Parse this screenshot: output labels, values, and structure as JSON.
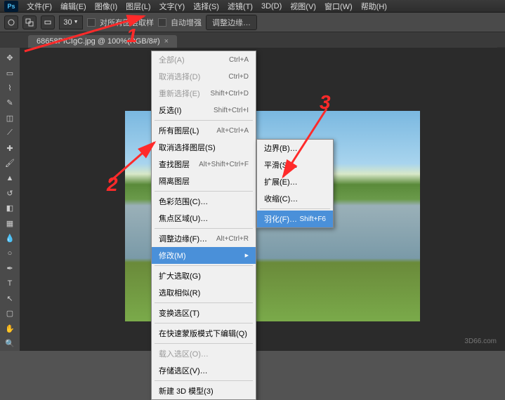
{
  "app": {
    "logo": "Ps"
  },
  "menubar": [
    "文件(F)",
    "编辑(E)",
    "图像(I)",
    "图层(L)",
    "文字(Y)",
    "选择(S)",
    "滤镜(T)",
    "3D(D)",
    "视图(V)",
    "窗口(W)",
    "帮助(H)"
  ],
  "options": {
    "size_value": "30",
    "chk1_label": "对所有图层取样",
    "chk2_label": "自动增强",
    "refine_btn": "调整边缘…"
  },
  "document": {
    "tab_title": "68658PICIgC.jpg @ 100%(RGB/8#)",
    "close": "×"
  },
  "select_menu": [
    {
      "label": "全部(A)",
      "shortcut": "Ctrl+A",
      "disabled": true
    },
    {
      "label": "取消选择(D)",
      "shortcut": "Ctrl+D",
      "disabled": true
    },
    {
      "label": "重新选择(E)",
      "shortcut": "Shift+Ctrl+D",
      "disabled": true
    },
    {
      "label": "反选(I)",
      "shortcut": "Shift+Ctrl+I"
    },
    {
      "sep": true
    },
    {
      "label": "所有图层(L)",
      "shortcut": "Alt+Ctrl+A"
    },
    {
      "label": "取消选择图层(S)"
    },
    {
      "label": "查找图层",
      "shortcut": "Alt+Shift+Ctrl+F"
    },
    {
      "label": "隔离图层"
    },
    {
      "sep": true
    },
    {
      "label": "色彩范围(C)…"
    },
    {
      "label": "焦点区域(U)…"
    },
    {
      "sep": true
    },
    {
      "label": "调整边缘(F)…",
      "shortcut": "Alt+Ctrl+R"
    },
    {
      "label": "修改(M)",
      "sub": true,
      "sel": true
    },
    {
      "sep": true
    },
    {
      "label": "扩大选取(G)"
    },
    {
      "label": "选取相似(R)"
    },
    {
      "sep": true
    },
    {
      "label": "变换选区(T)"
    },
    {
      "sep": true
    },
    {
      "label": "在快速蒙版模式下编辑(Q)"
    },
    {
      "sep": true
    },
    {
      "label": "载入选区(O)…",
      "disabled": true
    },
    {
      "label": "存储选区(V)…"
    },
    {
      "sep": true
    },
    {
      "label": "新建 3D 模型(3)"
    }
  ],
  "modify_submenu": [
    {
      "label": "边界(B)…"
    },
    {
      "label": "平滑(S)…"
    },
    {
      "label": "扩展(E)…"
    },
    {
      "label": "收缩(C)…"
    },
    {
      "sep": true
    },
    {
      "label": "羽化(F)…",
      "shortcut": "Shift+F6",
      "sel": true
    }
  ],
  "annotations": {
    "one": "1",
    "two": "2",
    "three": "3"
  },
  "watermark": "3D66.com",
  "colors": {
    "accent": "#4a90d9",
    "annotation": "#ff2a2a"
  }
}
